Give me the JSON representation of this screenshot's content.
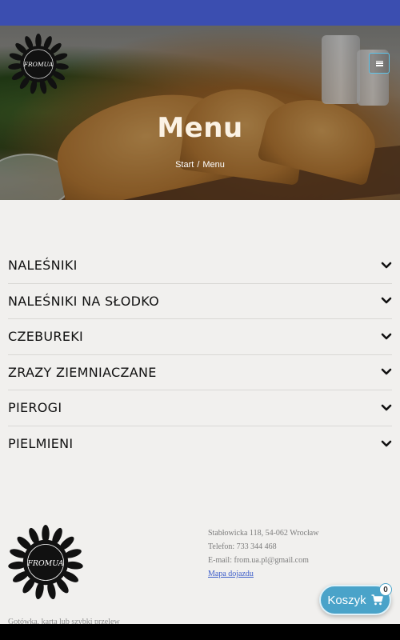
{
  "header": {
    "title": "Menu",
    "breadcrumb": {
      "home": "Start",
      "separator": "/",
      "current": "Menu"
    },
    "logo_text": "FROMUA",
    "accent_color": "#3b4eb0"
  },
  "menu": {
    "categories": [
      {
        "label": "NALEŚNIKI"
      },
      {
        "label": "NALEŚNIKI NA SŁODKO"
      },
      {
        "label": "CZEBUREKI"
      },
      {
        "label": "ZRAZY ZIEMNIACZANE"
      },
      {
        "label": "PIEROGI"
      },
      {
        "label": "PIELMIENI"
      }
    ],
    "expand_icon": "chevron-down-icon"
  },
  "footer": {
    "logo_text": "FROMUA",
    "address": "Stabłowicka 118, 54-062 Wrocław",
    "phone": "Telefon: 733 344 468",
    "email": "E-mail: from.ua.pl@gmail.com",
    "map_link": "Mapa dojazdu",
    "payment_note": "Gotówka, karta lub szybki przelew"
  },
  "cart": {
    "label": "Koszyk",
    "count": "0",
    "icon": "cart-icon",
    "color": "#4aa3c9"
  }
}
